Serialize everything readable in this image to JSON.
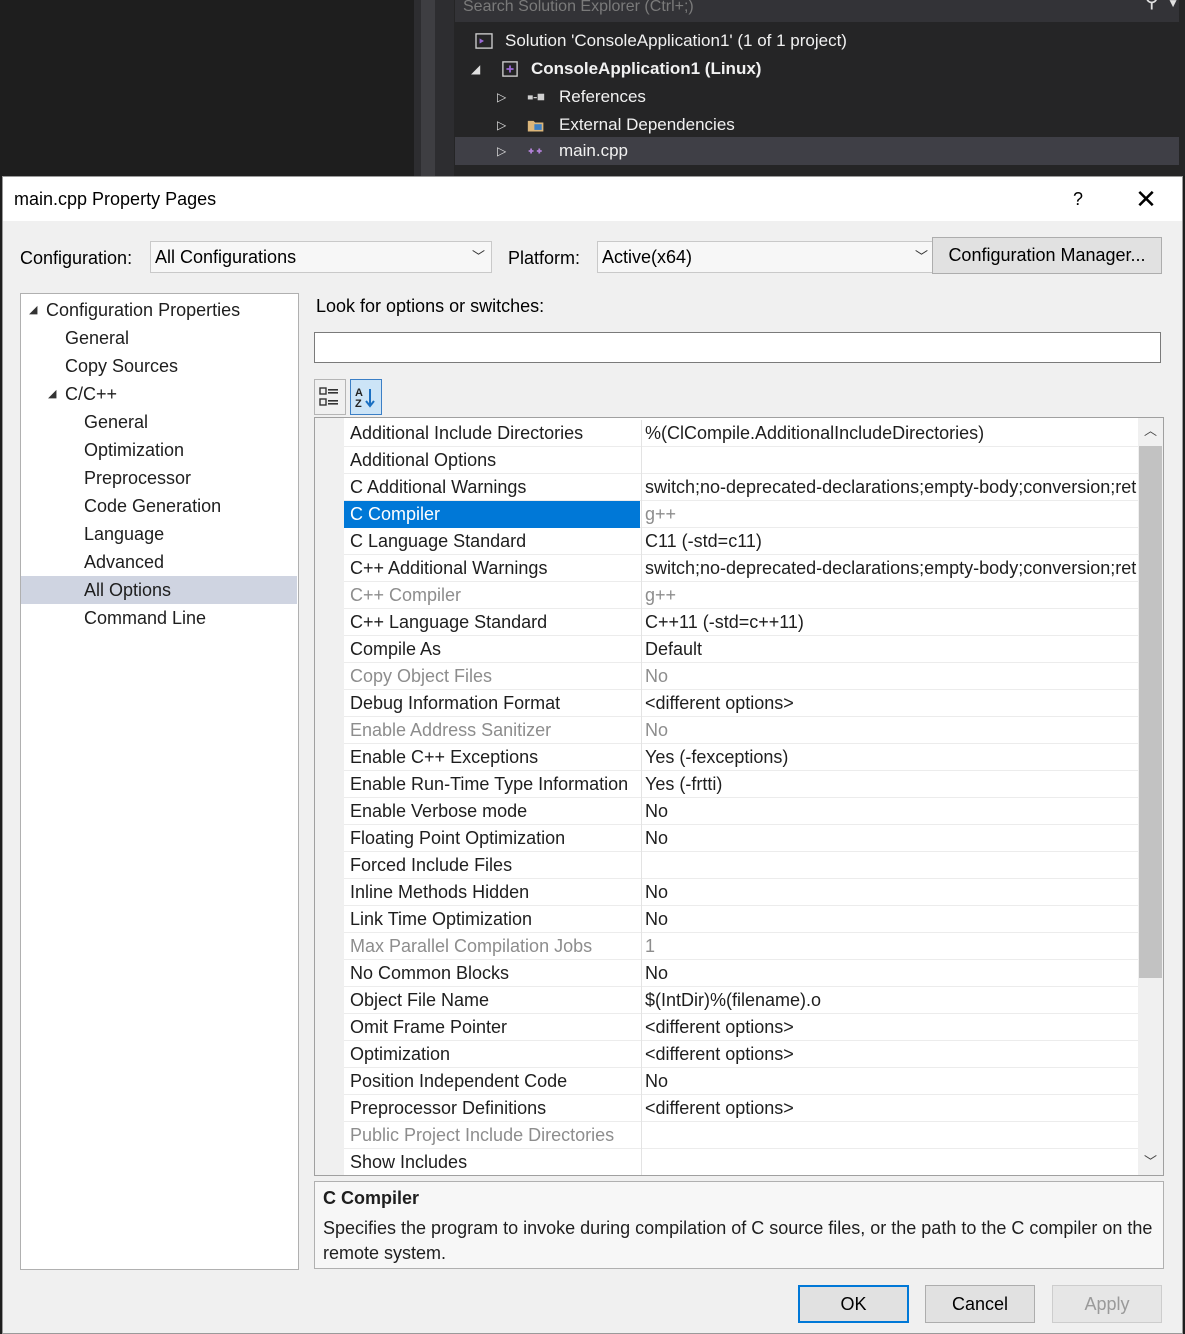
{
  "solution_explorer": {
    "search_placeholder": "Search Solution Explorer (Ctrl+;)",
    "items": [
      {
        "label": "Solution 'ConsoleApplication1' (1 of 1 project)"
      },
      {
        "label": "ConsoleApplication1 (Linux)"
      },
      {
        "label": "References"
      },
      {
        "label": "External Dependencies"
      },
      {
        "label": "main.cpp"
      }
    ]
  },
  "dialog": {
    "title": "main.cpp Property Pages",
    "help": "?",
    "close": "✕",
    "configuration_label": "Configuration:",
    "configuration_value": "All Configurations",
    "platform_label": "Platform:",
    "platform_value": "Active(x64)",
    "config_manager": "Configuration Manager...",
    "search_label": "Look for options or switches:",
    "ok": "OK",
    "cancel": "Cancel",
    "apply": "Apply"
  },
  "nav": [
    {
      "label": "Configuration Properties"
    },
    {
      "label": "General"
    },
    {
      "label": "Copy Sources"
    },
    {
      "label": "C/C++"
    },
    {
      "label": "General"
    },
    {
      "label": "Optimization"
    },
    {
      "label": "Preprocessor"
    },
    {
      "label": "Code Generation"
    },
    {
      "label": "Language"
    },
    {
      "label": "Advanced"
    },
    {
      "label": "All Options"
    },
    {
      "label": "Command Line"
    }
  ],
  "properties": [
    {
      "name": "Additional Include Directories",
      "value": "%(ClCompile.AdditionalIncludeDirectories)"
    },
    {
      "name": "Additional Options",
      "value": ""
    },
    {
      "name": "C Additional Warnings",
      "value": "switch;no-deprecated-declarations;empty-body;conversion;ret"
    },
    {
      "name": "C Compiler",
      "value": "g++"
    },
    {
      "name": "C Language Standard",
      "value": "C11 (-std=c11)"
    },
    {
      "name": "C++ Additional Warnings",
      "value": "switch;no-deprecated-declarations;empty-body;conversion;ret"
    },
    {
      "name": "C++ Compiler",
      "value": "g++"
    },
    {
      "name": "C++ Language Standard",
      "value": "C++11 (-std=c++11)"
    },
    {
      "name": "Compile As",
      "value": "Default"
    },
    {
      "name": "Copy Object Files",
      "value": "No"
    },
    {
      "name": "Debug Information Format",
      "value": "<different options>"
    },
    {
      "name": "Enable Address Sanitizer",
      "value": "No"
    },
    {
      "name": "Enable C++ Exceptions",
      "value": "Yes (-fexceptions)"
    },
    {
      "name": "Enable Run-Time Type Information",
      "value": "Yes (-frtti)"
    },
    {
      "name": "Enable Verbose mode",
      "value": "No"
    },
    {
      "name": "Floating Point Optimization",
      "value": "No"
    },
    {
      "name": "Forced Include Files",
      "value": ""
    },
    {
      "name": "Inline Methods Hidden",
      "value": "No"
    },
    {
      "name": "Link Time Optimization",
      "value": "No"
    },
    {
      "name": "Max Parallel Compilation Jobs",
      "value": "1"
    },
    {
      "name": "No Common Blocks",
      "value": "No"
    },
    {
      "name": "Object File Name",
      "value": "$(IntDir)%(filename).o"
    },
    {
      "name": "Omit Frame Pointer",
      "value": "<different options>"
    },
    {
      "name": "Optimization",
      "value": "<different options>"
    },
    {
      "name": "Position Independent Code",
      "value": "No"
    },
    {
      "name": "Preprocessor Definitions",
      "value": "<different options>"
    },
    {
      "name": "Public Project Include Directories",
      "value": ""
    },
    {
      "name": "Show Includes",
      "value": ""
    }
  ],
  "description": {
    "title": "C Compiler",
    "text": "Specifies the program to invoke during compilation of C source files, or the path to the C compiler on the remote system."
  },
  "colors": {
    "selection": "#0078d7",
    "nav_selection": "#cfd4e1",
    "ide_background": "#252526",
    "disabled_text": "#8d8d8d"
  }
}
